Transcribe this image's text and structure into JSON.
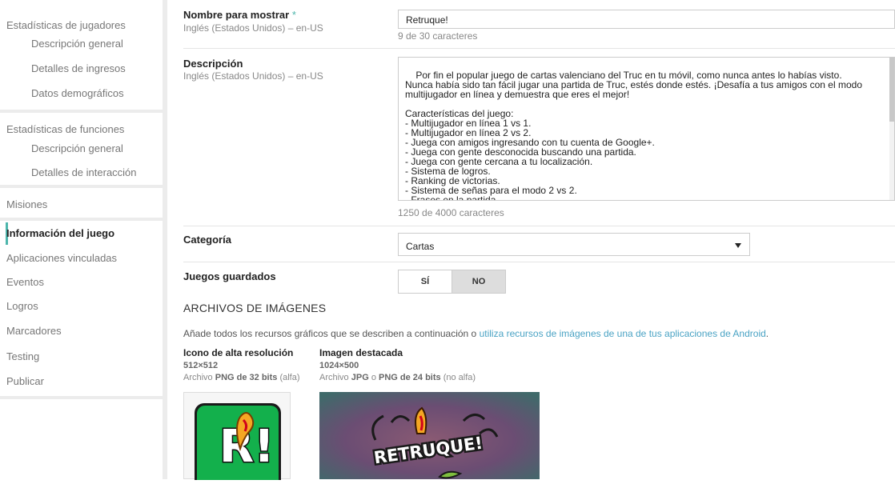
{
  "sidebar": {
    "player_stats": {
      "title": "Estadísticas de jugadores",
      "items": [
        "Descripción general",
        "Detalles de ingresos",
        "Datos demográficos"
      ]
    },
    "feature_stats": {
      "title": "Estadísticas de funciones",
      "items": [
        "Descripción general",
        "Detalles de interacción"
      ]
    },
    "nav": [
      {
        "label": "Misiones",
        "active": false
      },
      {
        "label": "Información del juego",
        "active": true
      },
      {
        "label": "Aplicaciones vinculadas",
        "active": false
      },
      {
        "label": "Eventos",
        "active": false
      },
      {
        "label": "Logros",
        "active": false
      },
      {
        "label": "Marcadores",
        "active": false
      },
      {
        "label": "Testing",
        "active": false
      },
      {
        "label": "Publicar",
        "active": false
      }
    ]
  },
  "form": {
    "display_name": {
      "label": "Nombre para mostrar",
      "required_mark": "*",
      "locale": "Inglés (Estados Unidos) – en-US",
      "value": "Retruque!",
      "counter": "9 de 30 caracteres"
    },
    "description": {
      "label": "Descripción",
      "locale": "Inglés (Estados Unidos) – en-US",
      "value": "Por fin el popular juego de cartas valenciano del Truc en tu móvil, como nunca antes lo habías visto. Nunca había sido tan fácil jugar una partida de Truc, estés donde estés. ¡Desafía a tus amigos con el modo multijugador en línea y demuestra que eres el mejor!\n\nCaracterísticas del juego:\n- Multijugador en línea 1 vs 1.\n- Multijugador en línea 2 vs 2.\n- Juega con amigos ingresando con tu cuenta de Google+.\n- Juega con gente desconocida buscando una partida.\n- Juega con gente cercana a tu localización.\n- Sistema de logros.\n- Ranking de victorias.\n- Sistema de señas para el modo 2 vs 2.\n- Frases en la partida.",
      "counter": "1250 de 4000 caracteres"
    },
    "category": {
      "label": "Categoría",
      "selected": "Cartas"
    },
    "saved_games": {
      "label": "Juegos guardados",
      "yes": "SÍ",
      "no": "NO",
      "selected": "NO"
    }
  },
  "images": {
    "section_title": "ARCHIVOS DE IMÁGENES",
    "description_prefix": "Añade todos los recursos gráficos que se describen a continuación o ",
    "description_link": "utiliza recursos de imágenes de una de tus aplicaciones de Android",
    "description_suffix": ".",
    "hi_res_icon": {
      "title": "Icono de alta resolución",
      "dimensions": "512×512",
      "format_prefix": "Archivo ",
      "format_bold": "PNG de 32 bits",
      "format_suffix": " (alfa)",
      "logo_text": "R!"
    },
    "feature_graphic": {
      "title": "Imagen destacada",
      "dimensions": "1024×500",
      "format_prefix": "Archivo ",
      "format_bold1": "JPG",
      "format_mid": " o ",
      "format_bold2": "PNG de 24 bits",
      "format_suffix": " (no alfa)",
      "logo_text": "RETRUQUE!"
    }
  }
}
